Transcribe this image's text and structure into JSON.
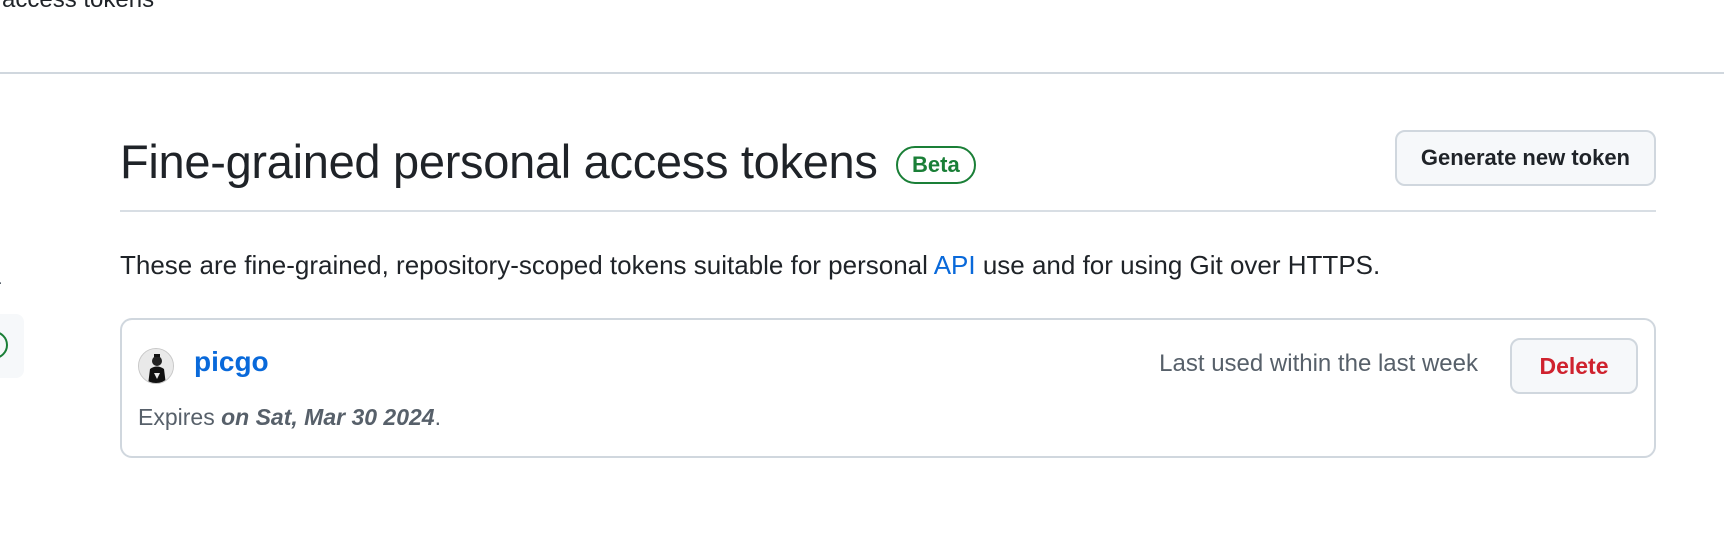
{
  "top": {
    "title_fragment": "access tokens"
  },
  "section": {
    "title": "Fine-grained personal access tokens",
    "badge": "Beta",
    "generate_button": "Generate new token"
  },
  "description": {
    "before_link": "These are fine-grained, repository-scoped tokens suitable for personal ",
    "link_text": "API",
    "after_link": " use and for using Git over HTTPS."
  },
  "tokens": [
    {
      "name": "picgo",
      "avatar_icon": "user-avatar",
      "last_used": "Last used within the last week",
      "delete_label": "Delete",
      "expires_prefix": "Expires ",
      "expires_date": "on Sat, Mar 30 2024",
      "expires_suffix": "."
    }
  ],
  "colors": {
    "link": "#0969da",
    "success": "#1a7f37",
    "danger": "#cf222e",
    "muted": "#57606a",
    "border": "#d0d7de"
  }
}
